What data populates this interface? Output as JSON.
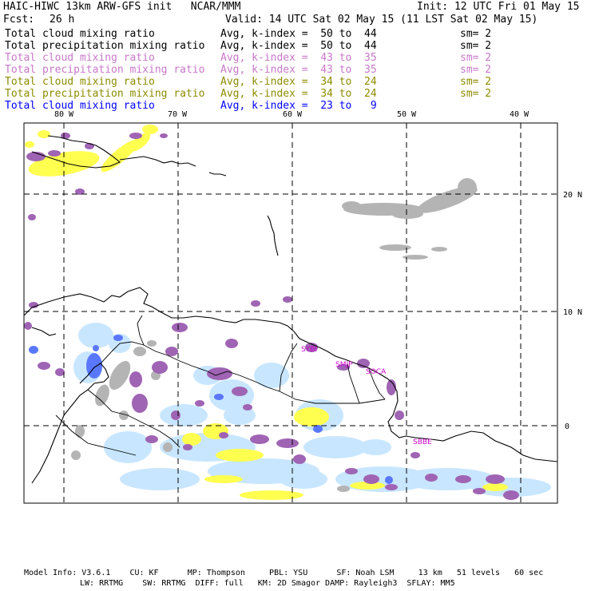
{
  "header": {
    "model": "HAIC-HIWC 13km ARW-GFS init   NCAR/MMM",
    "init": "Init: 12 UTC Fri 01 May 15",
    "fcst_label": "Fcst:",
    "fcst_value": "26 h",
    "valid": "Valid: 14 UTC Sat 02 May 15 (11 LST Sat 02 May 15)"
  },
  "fields": [
    {
      "name": "Total cloud mixing ratio",
      "avg": "Avg, k-index =  50 to  44",
      "sm": "sm= 2",
      "color": "#000000"
    },
    {
      "name": "Total precipitation mixing ratio",
      "avg": "Avg, k-index =  50 to  44",
      "sm": "sm= 2",
      "color": "#000000"
    },
    {
      "name": "Total cloud mixing ratio",
      "avg": "Avg, k-index =  43 to  35",
      "sm": "sm= 2",
      "color": "#c878c8"
    },
    {
      "name": "Total precipitation mixing ratio",
      "avg": "Avg, k-index =  43 to  35",
      "sm": "sm= 2",
      "color": "#c878c8"
    },
    {
      "name": "Total cloud mixing ratio",
      "avg": "Avg, k-index =  34 to  24",
      "sm": "sm= 2",
      "color": "#8c8c00"
    },
    {
      "name": "Total precipitation mixing ratio",
      "avg": "Avg, k-index =  34 to  24",
      "sm": "sm= 2",
      "color": "#8c8c00"
    },
    {
      "name": "Total cloud mixing ratio",
      "avg": "Avg, k-index =  23 to   9",
      "sm": "",
      "color": "#0000ff"
    }
  ],
  "map": {
    "lon_labels": [
      "80 W",
      "70 W",
      "60 W",
      "50 W",
      "40 W"
    ],
    "lat_labels": [
      "20 N",
      "10 N",
      "0"
    ],
    "stations": [
      "SYBI",
      "SMJP",
      "SOCA",
      "SBBE"
    ],
    "colors": {
      "gray": "#b4b4b4",
      "purple": "#a064b4",
      "yellow": "#ffff50",
      "lightblue": "#c8e6ff",
      "blue": "#5a78ff",
      "station": "#cc00cc"
    }
  },
  "footer": {
    "line1": "Model Info: V3.6.1    CU: KF      MP: Thompson     PBL: YSU      SF: Noah LSM     13 km   51 levels   60 sec",
    "line2": "LW: RRTMG    SW: RRTMG  DIFF: full   KM: 2D Smagor DAMP: Rayleigh3  SFLAY: MM5"
  }
}
